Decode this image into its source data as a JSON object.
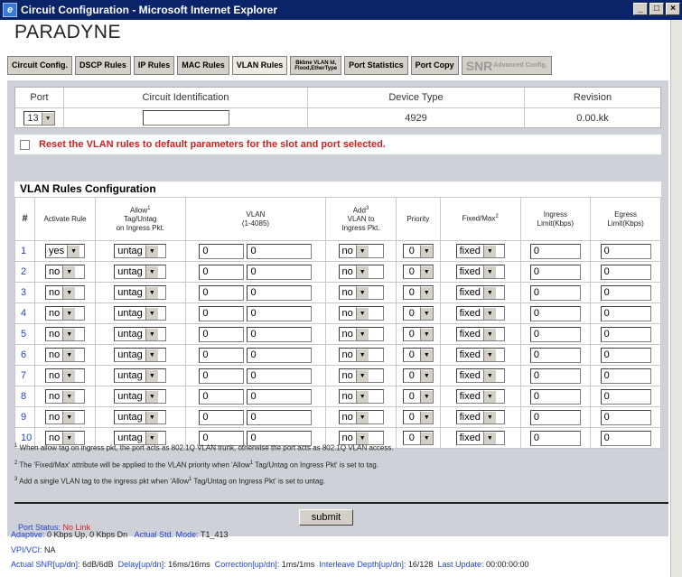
{
  "window": {
    "title": "Circuit Configuration - Microsoft Internet Explorer",
    "controls": [
      "_",
      "□",
      "×"
    ]
  },
  "logo": "PARADYNE",
  "tabs": [
    {
      "label": "Circuit Config.",
      "active": false
    },
    {
      "label": "DSCP Rules",
      "active": false
    },
    {
      "label": "IP Rules",
      "active": false
    },
    {
      "label": "MAC Rules",
      "active": false
    },
    {
      "label": "VLAN Rules",
      "active": true
    },
    {
      "label_line1": "Bkbne VLAN Id,",
      "label_line2": "Flood,EtherType"
    },
    {
      "label": "Port Statistics",
      "active": false
    },
    {
      "label": "Port Copy",
      "active": false
    },
    {
      "label_big": "SNR",
      "label_small": "Advanced Config."
    }
  ],
  "header": {
    "port_label": "Port",
    "circuit_label": "Circuit Identification",
    "device_label": "Device Type",
    "revision_label": "Revision",
    "port_value": "13",
    "circuit_value": "",
    "device_value": "4929",
    "revision_value": "0.00.kk"
  },
  "reset_text": "Reset the VLAN rules to default parameters for the slot and port selected.",
  "rules": {
    "title": "VLAN Rules Configuration",
    "columns": {
      "num": "#",
      "activate": "Activate Rule",
      "allow_a": "Allow",
      "allow_b": "Tag/Untag",
      "allow_c": "on Ingress Pkt.",
      "vlan_a": "VLAN",
      "vlan_b": "(1-4085)",
      "add_a": "Add",
      "add_b": "VLAN to",
      "add_c": "Ingress Pkt.",
      "priority": "Priority",
      "fixed": "Fixed/Max",
      "ingress_a": "Ingress",
      "ingress_b": "Limit(Kbps)",
      "egress_a": "Egress",
      "egress_b": "Limit(Kbps)"
    },
    "rows": [
      {
        "n": "1",
        "activate": "yes",
        "allow": "untag",
        "vlan1": "0",
        "vlan2": "0",
        "add": "no",
        "priority": "0",
        "fixed": "fixed",
        "ingress": "0",
        "egress": "0"
      },
      {
        "n": "2",
        "activate": "no",
        "allow": "untag",
        "vlan1": "0",
        "vlan2": "0",
        "add": "no",
        "priority": "0",
        "fixed": "fixed",
        "ingress": "0",
        "egress": "0"
      },
      {
        "n": "3",
        "activate": "no",
        "allow": "untag",
        "vlan1": "0",
        "vlan2": "0",
        "add": "no",
        "priority": "0",
        "fixed": "fixed",
        "ingress": "0",
        "egress": "0"
      },
      {
        "n": "4",
        "activate": "no",
        "allow": "untag",
        "vlan1": "0",
        "vlan2": "0",
        "add": "no",
        "priority": "0",
        "fixed": "fixed",
        "ingress": "0",
        "egress": "0"
      },
      {
        "n": "5",
        "activate": "no",
        "allow": "untag",
        "vlan1": "0",
        "vlan2": "0",
        "add": "no",
        "priority": "0",
        "fixed": "fixed",
        "ingress": "0",
        "egress": "0"
      },
      {
        "n": "6",
        "activate": "no",
        "allow": "untag",
        "vlan1": "0",
        "vlan2": "0",
        "add": "no",
        "priority": "0",
        "fixed": "fixed",
        "ingress": "0",
        "egress": "0"
      },
      {
        "n": "7",
        "activate": "no",
        "allow": "untag",
        "vlan1": "0",
        "vlan2": "0",
        "add": "no",
        "priority": "0",
        "fixed": "fixed",
        "ingress": "0",
        "egress": "0"
      },
      {
        "n": "8",
        "activate": "no",
        "allow": "untag",
        "vlan1": "0",
        "vlan2": "0",
        "add": "no",
        "priority": "0",
        "fixed": "fixed",
        "ingress": "0",
        "egress": "0"
      },
      {
        "n": "9",
        "activate": "no",
        "allow": "untag",
        "vlan1": "0",
        "vlan2": "0",
        "add": "no",
        "priority": "0",
        "fixed": "fixed",
        "ingress": "0",
        "egress": "0"
      },
      {
        "n": "10",
        "activate": "no",
        "allow": "untag",
        "vlan1": "0",
        "vlan2": "0",
        "add": "no",
        "priority": "0",
        "fixed": "fixed",
        "ingress": "0",
        "egress": "0"
      }
    ]
  },
  "footnotes": {
    "fn1": "When allow tag on ingress pkt, the port acts as 802.1Q VLAN trunk, otherwise the port acts as 802.1Q VLAN access.",
    "fn2a": "The 'Fixed/Max' attribute will be applied to the VLAN priority when 'Allow",
    "fn2b": " Tag/Untag on Ingress Pkt' is set to tag.",
    "fn3a": "Add a single VLAN tag to the ingress pkt when 'Allow",
    "fn3b": " Tag/Untag on Ingress Pkt' is set to untag."
  },
  "submit_label": "submit",
  "status": {
    "port_status_label": "Port Status:",
    "port_status_value": "No Link",
    "adaptive_label": "Adaptive:",
    "adaptive_value": "0 Kbps Up, 0 Kbps Dn",
    "std_mode_label": "Actual Std. Mode:",
    "std_mode_value": "T1_413",
    "vpivci_label": "VPI/VCI:",
    "vpivci_value": "NA",
    "snr_label": "Actual SNR[up/dn]:",
    "snr_value": "6dB/6dB",
    "delay_label": "Delay[up/dn]:",
    "delay_value": "16ms/16ms",
    "correction_label": "Correction[up/dn]:",
    "correction_value": "1ms/1ms",
    "interleave_label": "Interleave Depth[up/dn]:",
    "interleave_value": "16/128",
    "last_update_label": "Last Update:",
    "last_update_value": "00:00:00:00"
  }
}
